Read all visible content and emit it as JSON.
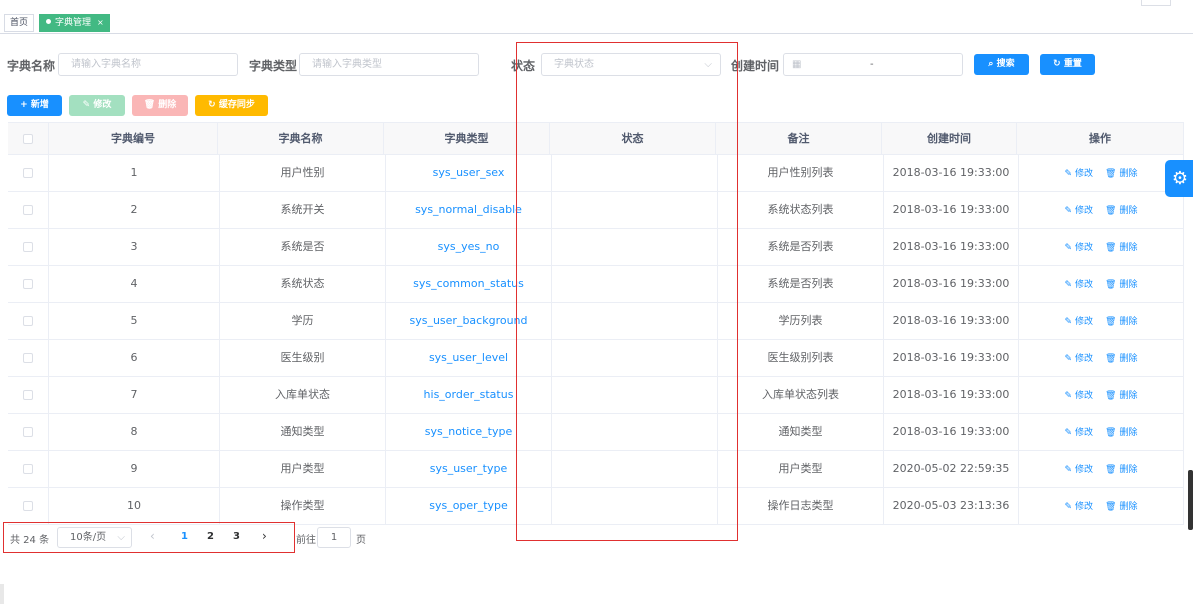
{
  "tags": {
    "home": "首页",
    "active": "字典管理",
    "close": "×"
  },
  "search": {
    "name_label": "字典名称",
    "name_placeholder": "请输入字典名称",
    "type_label": "字典类型",
    "type_placeholder": "请输入字典类型",
    "status_label": "状态",
    "status_placeholder": "字典状态",
    "time_label": "创建时间",
    "time_separator": "-",
    "search_btn": "搜索",
    "reset_btn": "重置"
  },
  "toolbar": {
    "add": "新增",
    "edit": "修改",
    "delete": "删除",
    "sync": "缓存同步"
  },
  "table": {
    "headers": [
      "字典编号",
      "字典名称",
      "字典类型",
      "状态",
      "备注",
      "创建时间",
      "操作"
    ],
    "rows": [
      {
        "id": "1",
        "name": "用户性别",
        "type": "sys_user_sex",
        "remark": "用户性别列表",
        "time": "2018-03-16 19:33:00"
      },
      {
        "id": "2",
        "name": "系统开关",
        "type": "sys_normal_disable",
        "remark": "系统状态列表",
        "time": "2018-03-16 19:33:00"
      },
      {
        "id": "3",
        "name": "系统是否",
        "type": "sys_yes_no",
        "remark": "系统是否列表",
        "time": "2018-03-16 19:33:00"
      },
      {
        "id": "4",
        "name": "系统状态",
        "type": "sys_common_status",
        "remark": "系统是否列表",
        "time": "2018-03-16 19:33:00"
      },
      {
        "id": "5",
        "name": "学历",
        "type": "sys_user_background",
        "remark": "学历列表",
        "time": "2018-03-16 19:33:00"
      },
      {
        "id": "6",
        "name": "医生级别",
        "type": "sys_user_level",
        "remark": "医生级别列表",
        "time": "2018-03-16 19:33:00"
      },
      {
        "id": "7",
        "name": "入库单状态",
        "type": "his_order_status",
        "remark": "入库单状态列表",
        "time": "2018-03-16 19:33:00"
      },
      {
        "id": "8",
        "name": "通知类型",
        "type": "sys_notice_type",
        "remark": "通知类型",
        "time": "2018-03-16 19:33:00"
      },
      {
        "id": "9",
        "name": "用户类型",
        "type": "sys_user_type",
        "remark": "用户类型",
        "time": "2020-05-02 22:59:35"
      },
      {
        "id": "10",
        "name": "操作类型",
        "type": "sys_oper_type",
        "remark": "操作日志类型",
        "time": "2020-05-03 23:13:36"
      }
    ],
    "op_edit": "修改",
    "op_delete": "删除"
  },
  "pagination": {
    "total": "共 24 条",
    "page_size": "10条/页",
    "pages": [
      "1",
      "2",
      "3"
    ],
    "current": "1",
    "goto_label": "前往",
    "goto_value": "1",
    "unit": "页"
  },
  "colors": {
    "primary": "#1890ff",
    "success": "#42b983",
    "annotation": "#e03030"
  }
}
